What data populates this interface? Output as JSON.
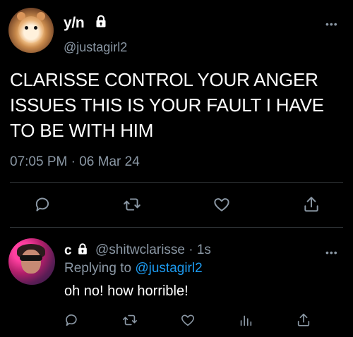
{
  "main_tweet": {
    "display_name": "y/n",
    "handle": "@justagirl2",
    "more": "•••",
    "text": "CLARISSE CONTROL YOUR ANGER ISSUES THIS IS YOUR FAULT I HAVE TO BE WITH HIM",
    "timestamp": "07:05 PM · 06 Mar 24",
    "actions": [
      "reply-icon",
      "retweet-icon",
      "like-icon",
      "share-icon"
    ]
  },
  "reply_tweet": {
    "display_name": "c",
    "handle_time": "@shitwclarisse · 1s",
    "replying_prefix": "Replying to ",
    "replying_to": "@justagirl2",
    "text": "oh no! how horrible!",
    "more": "•••",
    "actions": [
      "reply-icon",
      "retweet-icon",
      "like-icon",
      "analytics-icon",
      "share-icon"
    ]
  },
  "colors": {
    "background": "#000000",
    "text": "#ffffff",
    "secondary": "#8b98a5",
    "link": "#1d9bf0",
    "divider": "#2f3336"
  }
}
